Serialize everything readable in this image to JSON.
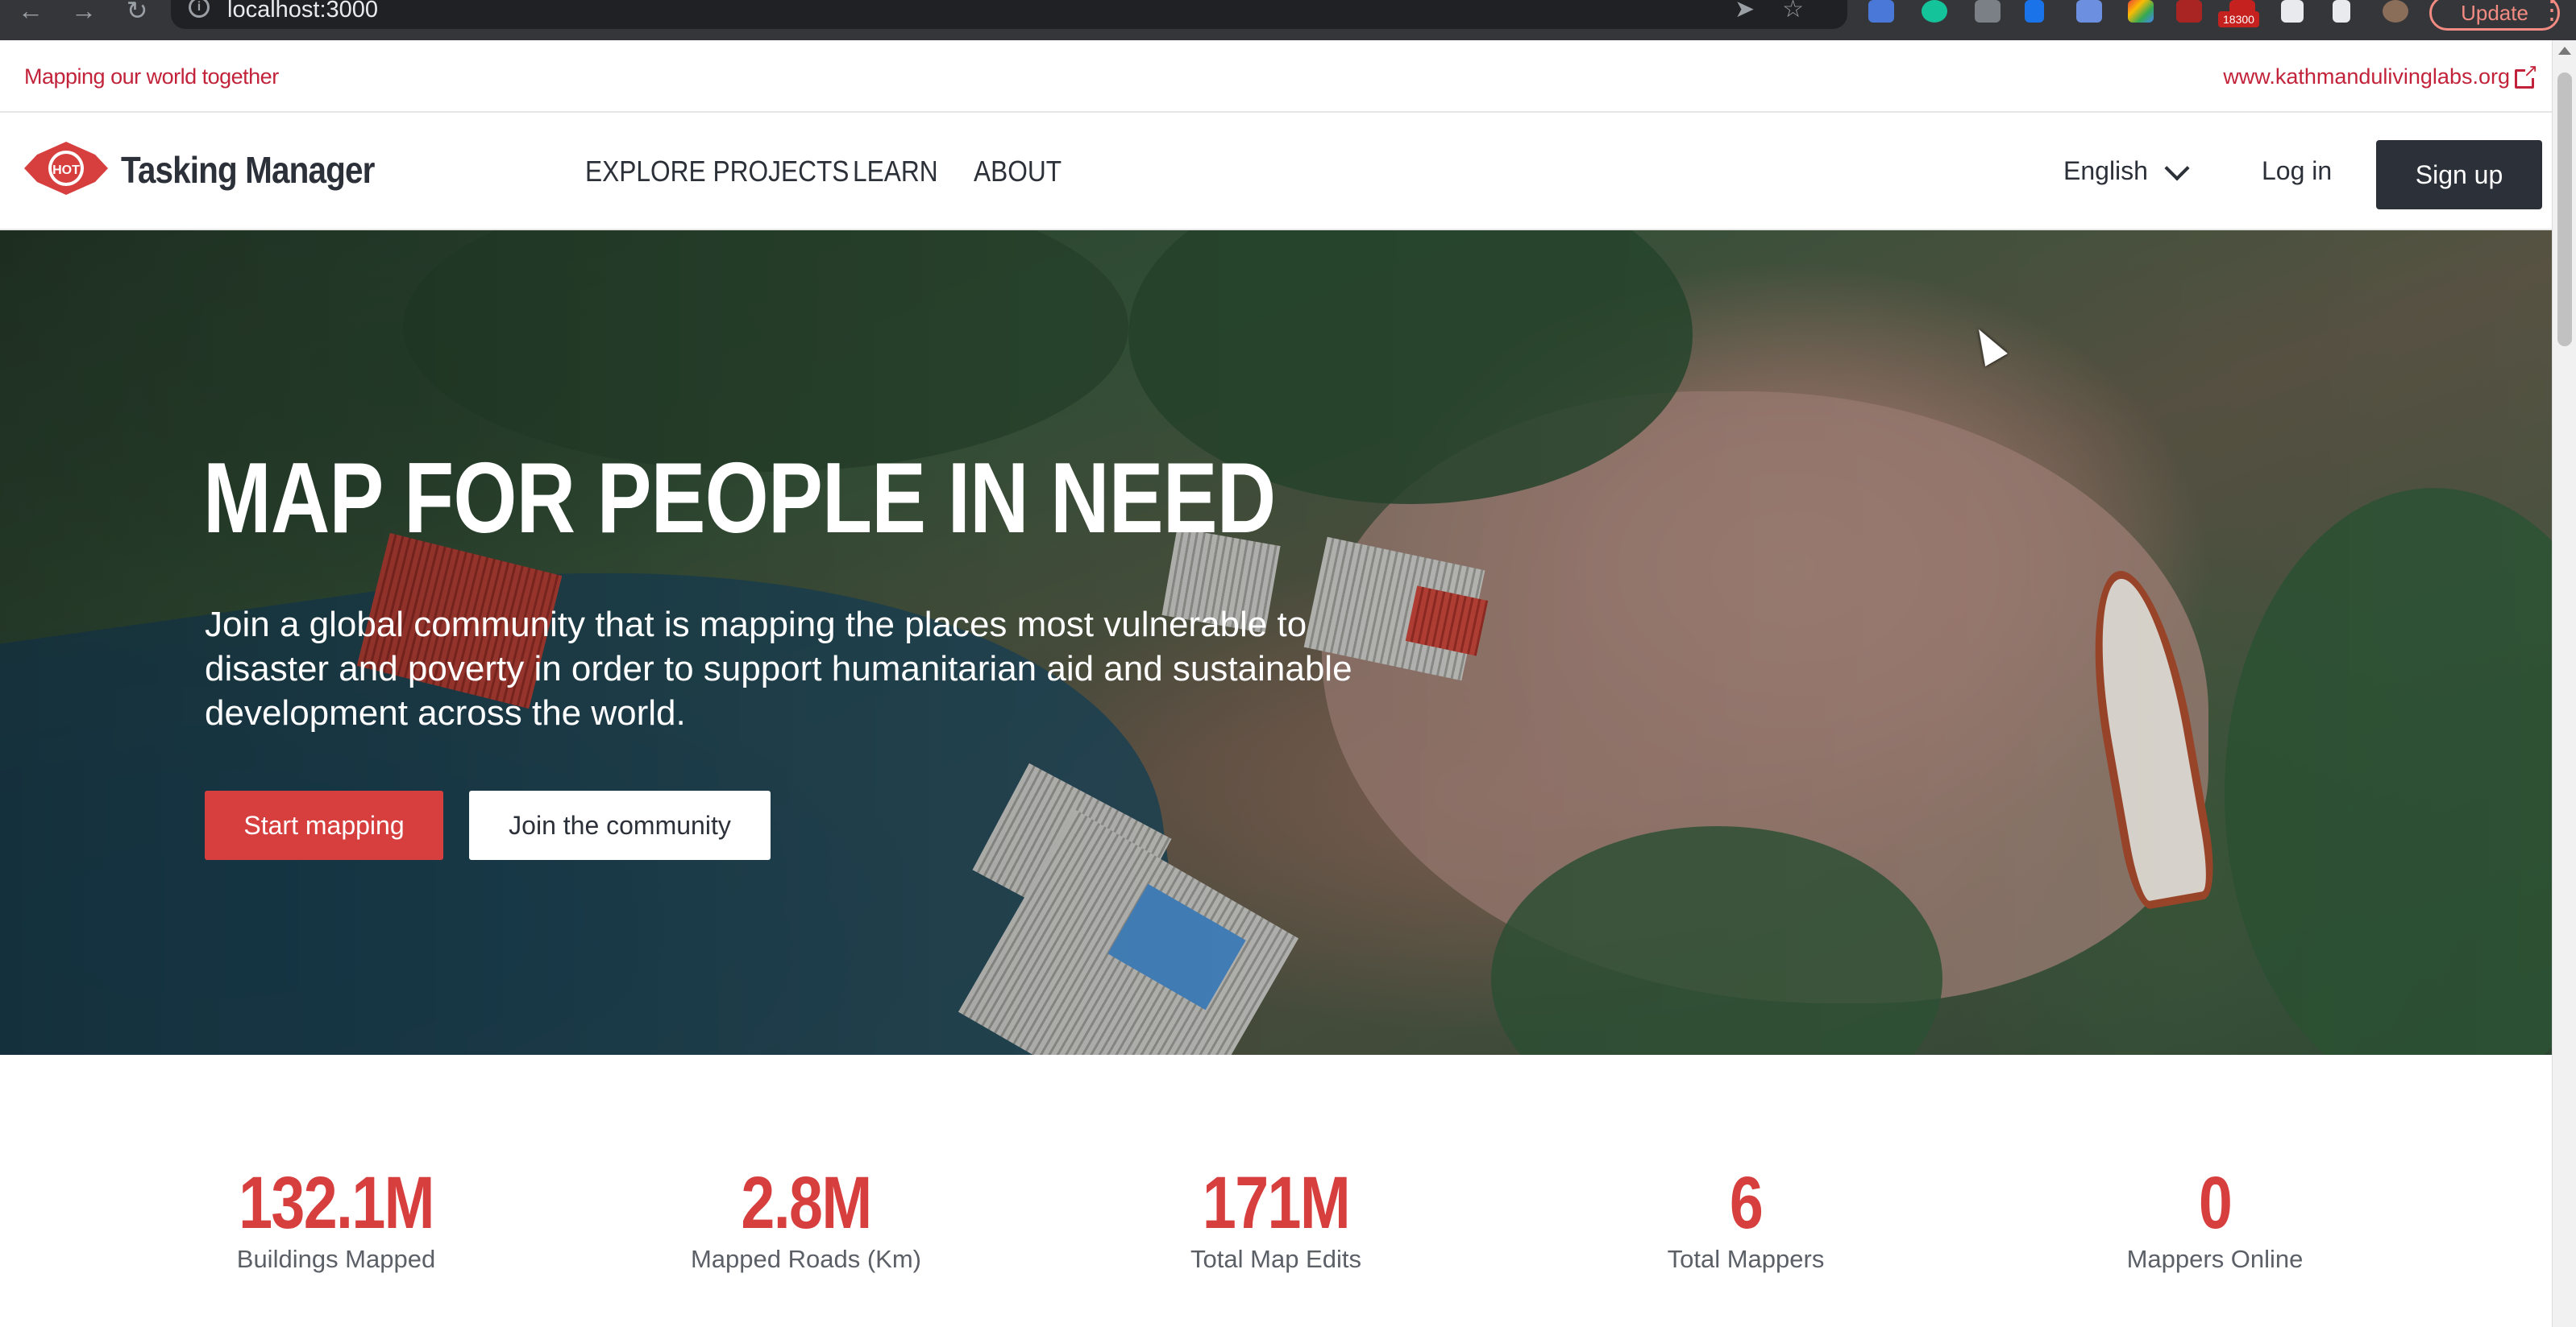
{
  "browser": {
    "url": "localhost:3000",
    "back_icon": "arrow-left-icon",
    "forward_icon": "arrow-right-icon",
    "reload_icon": "reload-icon",
    "extension_badge": "18300",
    "update_label": "Update"
  },
  "topstrip": {
    "tagline": "Mapping our world together",
    "external_link": "www.kathmandulivinglabs.org"
  },
  "header": {
    "logo_text": "HOT",
    "brand": "Tasking Manager",
    "nav": [
      {
        "label": "EXPLORE PROJECTS"
      },
      {
        "label": "LEARN"
      },
      {
        "label": "ABOUT"
      }
    ],
    "language": "English",
    "login": "Log in",
    "signup": "Sign up"
  },
  "hero": {
    "title": "MAP FOR PEOPLE IN NEED",
    "subtitle": "Join a global community that is mapping the places most vulnerable to disaster and poverty in order to support humanitarian aid and sustainable development across the world.",
    "primary_button": "Start mapping",
    "secondary_button": "Join the community"
  },
  "stats": [
    {
      "value": "132.1M",
      "label": "Buildings Mapped"
    },
    {
      "value": "2.8M",
      "label": "Mapped Roads (Km)"
    },
    {
      "value": "171M",
      "label": "Total Map Edits"
    },
    {
      "value": "6",
      "label": "Total Mappers"
    },
    {
      "value": "0",
      "label": "Mappers Online"
    }
  ],
  "colors": {
    "brand_red": "#d73f3f",
    "dark": "#2c3038",
    "chrome_bg": "#35363a"
  }
}
